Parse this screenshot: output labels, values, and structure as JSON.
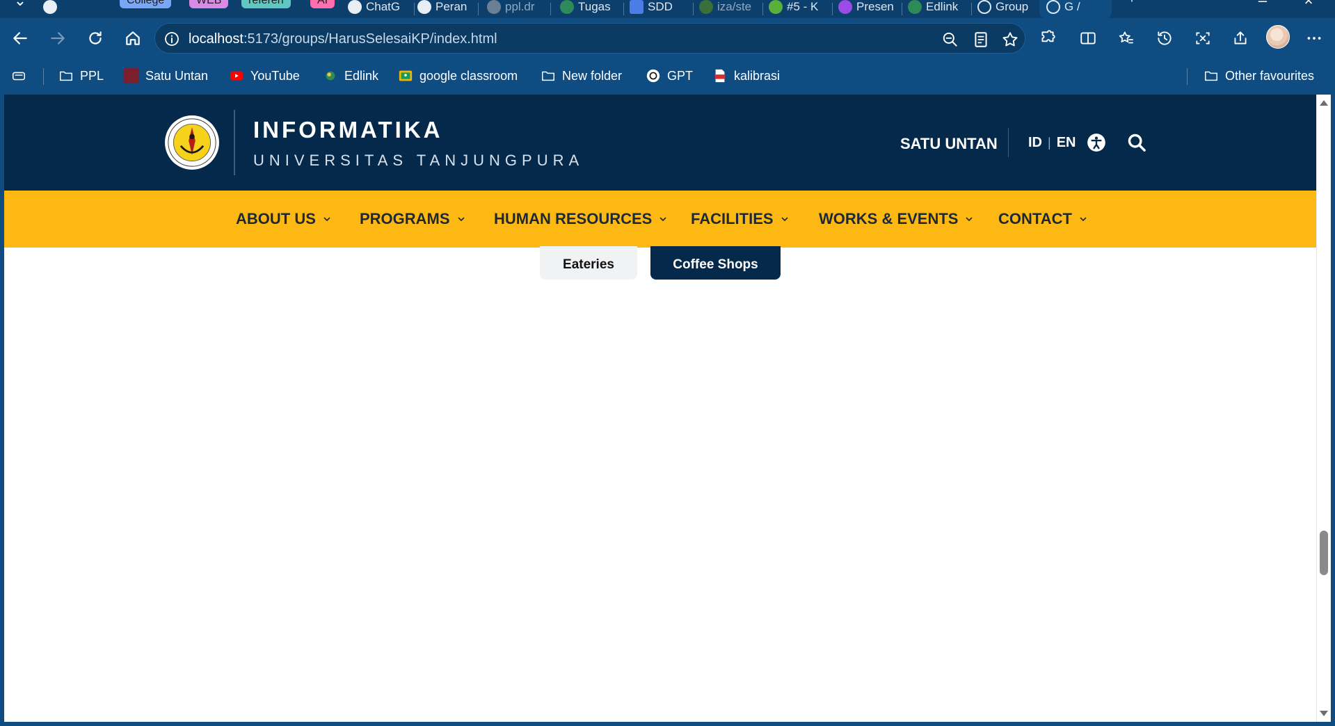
{
  "browser": {
    "tabs": [
      {
        "label": "College",
        "kind": "group",
        "color": "#7aa7f5"
      },
      {
        "label": "WEB",
        "kind": "group",
        "color": "#d98ae6"
      },
      {
        "label": "referen",
        "kind": "group",
        "color": "#5fc6c0"
      },
      {
        "label": "AI",
        "kind": "group",
        "color": "#ff6fae"
      },
      {
        "label": "ChatG",
        "kind": "tab"
      },
      {
        "label": "Peran",
        "kind": "tab"
      },
      {
        "label": "ppl.dr",
        "kind": "tab"
      },
      {
        "label": "Tugas",
        "kind": "tab"
      },
      {
        "label": "SDD",
        "kind": "tab"
      },
      {
        "label": "iza/ste",
        "kind": "tab"
      },
      {
        "label": "#5 - K",
        "kind": "tab"
      },
      {
        "label": "Presen",
        "kind": "tab"
      },
      {
        "label": "Edlink",
        "kind": "tab"
      },
      {
        "label": "Group",
        "kind": "tab"
      },
      {
        "label": "G /",
        "kind": "tab"
      }
    ],
    "address": {
      "host": "localhost",
      "path": ":5173/groups/HarusSelesaiKP/index.html"
    },
    "favourites": [
      {
        "label": "PPL",
        "icon": "folder-icon"
      },
      {
        "label": "Satu Untan",
        "icon": "untan-icon"
      },
      {
        "label": "YouTube",
        "icon": "youtube-icon"
      },
      {
        "label": "Edlink",
        "icon": "edlink-icon"
      },
      {
        "label": "google classroom",
        "icon": "classroom-icon"
      },
      {
        "label": "New folder",
        "icon": "folder-icon"
      },
      {
        "label": "GPT",
        "icon": "openai-icon"
      },
      {
        "label": "kalibrasi",
        "icon": "pdf-icon"
      }
    ],
    "other_favourites": "Other favourites"
  },
  "site": {
    "title": "INFORMATIKA",
    "subtitle": "UNIVERSITAS TANJUNGPURA",
    "satu_untan": "SATU UNTAN",
    "lang_id": "ID",
    "lang_sep": "|",
    "lang_en": "EN",
    "colors": {
      "header": "#05294a",
      "menu": "#fdb813",
      "active_tab": "#05294a"
    },
    "menu": [
      {
        "label": "ABOUT US"
      },
      {
        "label": "PROGRAMS"
      },
      {
        "label": "HUMAN RESOURCES"
      },
      {
        "label": "FACILITIES"
      },
      {
        "label": "WORKS & EVENTS"
      },
      {
        "label": "CONTACT"
      }
    ],
    "filters": {
      "eateries": "Eateries",
      "coffee": "Coffee Shops",
      "active": "Coffee Shops"
    }
  }
}
